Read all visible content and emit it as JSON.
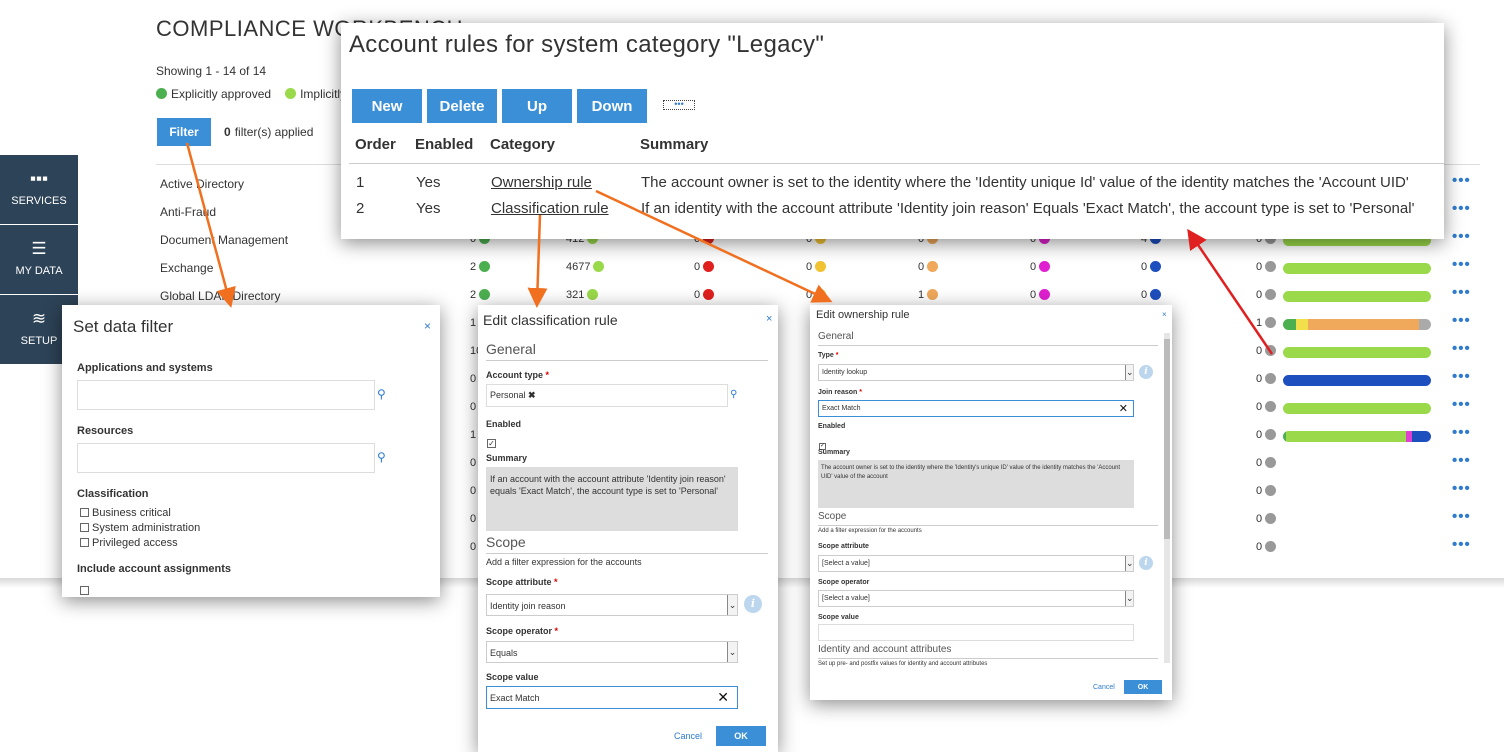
{
  "workbench": {
    "title": "COMPLIANCE WORKBENCH",
    "showing": "Showing 1 - 14 of 14",
    "legend": [
      {
        "label": "Explicitly approved",
        "color": "#4caf50"
      },
      {
        "label": "Implicitly approved",
        "color": "#9ad94a"
      }
    ],
    "filter_button": "Filter",
    "filter_count": "0",
    "filter_count_label": "filter(s) applied",
    "more_icon": "•••"
  },
  "sidebar": {
    "items": [
      {
        "label": "SERVICES",
        "icon": "grid-icon",
        "glyph": "▪▪▪"
      },
      {
        "label": "MY DATA",
        "icon": "menu-icon",
        "glyph": "☰"
      },
      {
        "label": "SETUP",
        "icon": "layers-icon",
        "glyph": "≋"
      }
    ]
  },
  "systems": [
    {
      "name": "Active Directory",
      "c": [],
      "bar": []
    },
    {
      "name": "Anti-Fraud",
      "c": [],
      "bar": []
    },
    {
      "name": "Document Management",
      "c": [
        "0",
        "412",
        "0",
        "0",
        "0",
        "0",
        "4",
        "0"
      ],
      "bar": [
        [
          "#9ad94a",
          100
        ]
      ]
    },
    {
      "name": "Exchange",
      "c": [
        "2",
        "4677",
        "0",
        "0",
        "0",
        "0",
        "0",
        "0"
      ],
      "bar": [
        [
          "#9ad94a",
          100
        ]
      ]
    },
    {
      "name": "Global LDAP Directory",
      "c": [
        "2",
        "321",
        "0",
        "0",
        "1",
        "0",
        "0",
        "0"
      ],
      "bar": [
        [
          "#9ad94a",
          100
        ]
      ]
    },
    {
      "name": "",
      "c": [
        "1",
        "",
        "",
        "",
        "",
        "",
        "",
        "1"
      ],
      "bar": [
        [
          "#4caf50",
          9
        ],
        [
          "#f1e04b",
          8
        ],
        [
          "#f0a85a",
          75
        ],
        [
          "#aaa",
          8
        ]
      ]
    },
    {
      "name": "",
      "c": [
        "10",
        "",
        "",
        "",
        "",
        "",
        "",
        "0"
      ],
      "bar": [
        [
          "#9ad94a",
          100
        ]
      ]
    },
    {
      "name": "",
      "c": [
        "0",
        "",
        "",
        "",
        "",
        "",
        "",
        "0"
      ],
      "bar": [
        [
          "#1e4fbf",
          100
        ]
      ]
    },
    {
      "name": "",
      "c": [
        "0",
        "",
        "",
        "",
        "",
        "",
        "",
        "0"
      ],
      "bar": [
        [
          "#9ad94a",
          100
        ]
      ]
    },
    {
      "name": "",
      "c": [
        "1",
        "",
        "",
        "",
        "",
        "",
        "",
        "0"
      ],
      "bar": [
        [
          "#4caf50",
          2
        ],
        [
          "#9ad94a",
          81
        ],
        [
          "#e040d0",
          4
        ],
        [
          "#1e4fbf",
          13
        ]
      ]
    },
    {
      "name": "",
      "c": [
        "0",
        "",
        "",
        "",
        "",
        "",
        "",
        "0"
      ],
      "bar": []
    },
    {
      "name": "",
      "c": [
        "0",
        "",
        "",
        "",
        "",
        "",
        "",
        "0"
      ],
      "bar": []
    },
    {
      "name": "",
      "c": [
        "0",
        "",
        "",
        "",
        "",
        "",
        "",
        "0"
      ],
      "bar": []
    },
    {
      "name": "",
      "c": [
        "0",
        "",
        "",
        "",
        "",
        "",
        "",
        "0"
      ],
      "bar": []
    }
  ],
  "column_colors": [
    "#4caf50",
    "#9ad94a",
    "#e0201e",
    "#f1c232",
    "#f0a85a",
    "#e020d0",
    "#1e4fbf",
    "#999999"
  ],
  "account_rules": {
    "title": "Account rules for system category \"Legacy\"",
    "buttons": {
      "new": "New",
      "delete": "Delete",
      "up": "Up",
      "down": "Down",
      "more": "•••"
    },
    "columns": {
      "order": "Order",
      "enabled": "Enabled",
      "category": "Category",
      "summary": "Summary"
    },
    "rows": [
      {
        "order": "1",
        "enabled": "Yes",
        "category": "Ownership rule",
        "summary": "The account owner is set to the identity where the 'Identity unique Id' value of the identity matches the 'Account UID'"
      },
      {
        "order": "2",
        "enabled": "Yes",
        "category": "Classification rule",
        "summary": "If an identity with the account attribute 'Identity join reason' Equals 'Exact Match', the account type is set to 'Personal'"
      }
    ]
  },
  "data_filter": {
    "title": "Set data filter",
    "close": "×",
    "apps_label": "Applications and systems",
    "resources_label": "Resources",
    "classification_label": "Classification",
    "options": [
      "Business critical",
      "System administration",
      "Privileged access"
    ],
    "include_label": "Include account assignments"
  },
  "classification_dialog": {
    "title": "Edit classification rule",
    "close": "×",
    "general": "General",
    "account_type_label": "Account type",
    "account_type_value": "Personal",
    "enabled_label": "Enabled",
    "summary_label": "Summary",
    "summary_text": "If an account with the account attribute 'Identity join reason' equals 'Exact Match', the account type is set to 'Personal'",
    "scope": "Scope",
    "scope_hint": "Add a filter expression for the accounts",
    "scope_attribute_label": "Scope attribute",
    "scope_attribute_value": "Identity join reason",
    "scope_operator_label": "Scope operator",
    "scope_operator_value": "Equals",
    "scope_value_label": "Scope value",
    "scope_value": "Exact Match",
    "cancel": "Cancel",
    "ok": "OK"
  },
  "ownership_dialog": {
    "title": "Edit ownership rule",
    "close": "×",
    "general": "General",
    "type_label": "Type",
    "type_value": "Identity lookup",
    "join_reason_label": "Join reason",
    "join_reason_value": "Exact Match",
    "enabled_label": "Enabled",
    "summary_label": "Summary",
    "summary_text": "The account owner is set to the identity where the 'Identity's unique ID' value of the identity matches the 'Account UID' value of the account",
    "scope": "Scope",
    "scope_hint": "Add a filter expression for the accounts",
    "scope_attribute_label": "Scope attribute",
    "scope_attribute_value": "[Select a value]",
    "scope_operator_label": "Scope operator",
    "scope_operator_value": "[Select a value]",
    "scope_value_label": "Scope value",
    "identity_attrs": "Identity and account attributes",
    "identity_attrs_hint": "Set up pre- and postfix values for identity and account attributes",
    "cancel": "Cancel",
    "ok": "OK"
  }
}
